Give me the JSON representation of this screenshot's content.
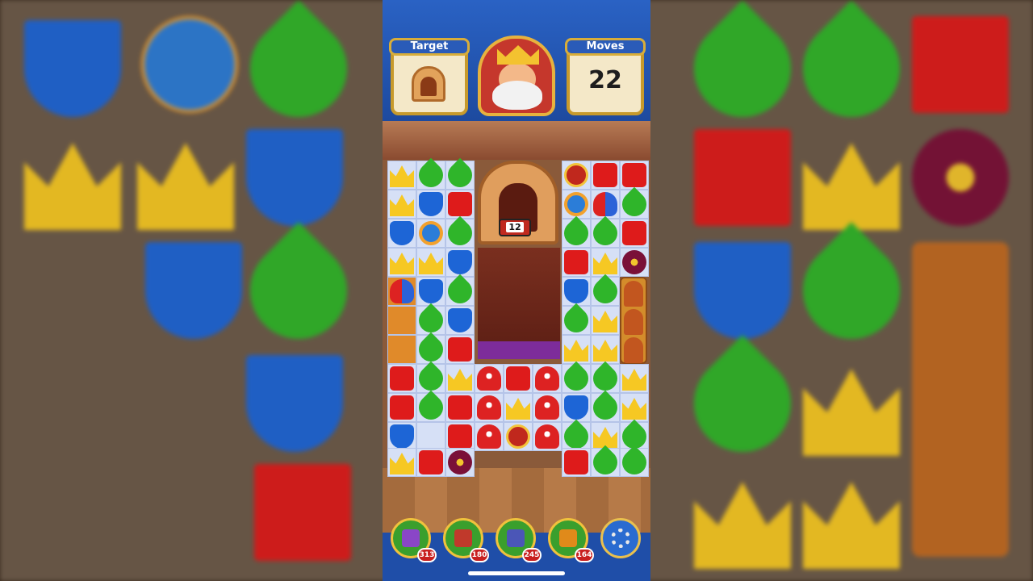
{
  "hud": {
    "target_label": "Target",
    "moves_label": "Moves",
    "moves_value": "22",
    "target_icon": "oven-icon",
    "avatar": "king-avatar"
  },
  "board": {
    "oven_counter": "12"
  },
  "boosters": [
    {
      "name": "hammer-booster",
      "count": "313",
      "color": "#8a46c7"
    },
    {
      "name": "arrow-booster",
      "count": "180",
      "color": "#c0392b"
    },
    {
      "name": "cannon-booster",
      "count": "245",
      "color": "#4b56b7"
    },
    {
      "name": "jester-hat-booster",
      "count": "164",
      "color": "#e08a1a"
    }
  ],
  "settings_icon": "gear-icon",
  "colors": {
    "hud_blue": "#1f4ea8",
    "gold": "#d8ad3a",
    "red_block": "#de1b1b",
    "green_leaf": "#2fb52a",
    "blue_shield": "#1d65d6",
    "yellow_crown": "#f6c823"
  }
}
